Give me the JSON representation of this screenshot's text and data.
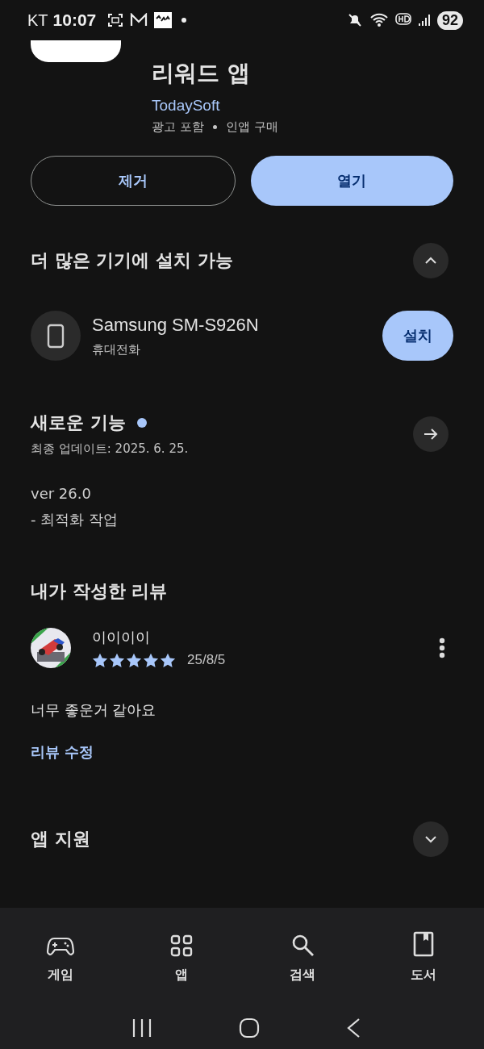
{
  "status_bar": {
    "carrier": "KT",
    "time": "10:07",
    "battery": "92"
  },
  "app": {
    "title": "리워드 앱",
    "developer": "TodaySoft",
    "meta": [
      "광고 포함",
      "인앱 구매"
    ]
  },
  "actions": [
    {
      "label": "제거",
      "kind": "outline"
    },
    {
      "label": "열기",
      "kind": "filled"
    }
  ],
  "devices_section": {
    "title": "더 많은 기기에 설치 가능",
    "expanded": true,
    "devices": [
      {
        "name": "Samsung SM-S926N",
        "type": "휴대전화",
        "button": "설치"
      }
    ]
  },
  "whats_new": {
    "title": "새로운 기능",
    "unread": true,
    "updated": "최종 업데이트: 2025. 6. 25.",
    "notes": [
      "ver 26.0",
      "- 최적화 작업"
    ]
  },
  "my_review": {
    "title": "내가 작성한 리뷰",
    "author": "이이이이",
    "stars": 5,
    "date": "25/8/5",
    "text": "너무 좋운거 같아요",
    "edit_link": "리뷰 수정"
  },
  "support_section": {
    "title": "앱 지원",
    "expanded": false
  },
  "bottom_nav": [
    {
      "label": "게임",
      "kind": "games"
    },
    {
      "label": "앱",
      "kind": "apps"
    },
    {
      "label": "검색",
      "kind": "search"
    },
    {
      "label": "도서",
      "kind": "books"
    }
  ]
}
